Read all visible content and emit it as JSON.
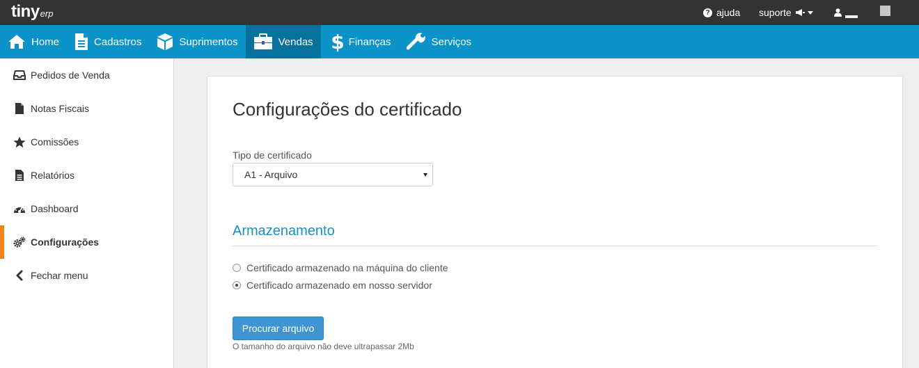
{
  "brand": {
    "name": "tiny",
    "suffix": "erp"
  },
  "topbar": {
    "help_label": "ajuda",
    "help_glyph": "?",
    "support_label": "suporte",
    "icons": [
      "help-circle-icon",
      "megaphone-icon",
      "caret-down-icon",
      "user-icon"
    ]
  },
  "mainnav": {
    "items": [
      {
        "label": "Home",
        "icon": "home-icon"
      },
      {
        "label": "Cadastros",
        "icon": "document-icon"
      },
      {
        "label": "Suprimentos",
        "icon": "box-icon"
      },
      {
        "label": "Vendas",
        "icon": "briefcase-icon",
        "active": true
      },
      {
        "label": "Finanças",
        "icon": "dollar-icon"
      },
      {
        "label": "Serviços",
        "icon": "wrench-icon"
      }
    ]
  },
  "sidebar": {
    "items": [
      {
        "label": "Pedidos de Venda",
        "icon": "inbox-icon"
      },
      {
        "label": "Notas Fiscais",
        "icon": "file-icon"
      },
      {
        "label": "Comissões",
        "icon": "star-icon"
      },
      {
        "label": "Relatórios",
        "icon": "report-icon"
      },
      {
        "label": "Dashboard",
        "icon": "dashboard-icon"
      },
      {
        "label": "Configurações",
        "icon": "cogs-icon",
        "active": true
      },
      {
        "label": "Fechar menu",
        "icon": "chevron-left-icon"
      }
    ]
  },
  "main": {
    "title": "Configurações do certificado",
    "cert_type_label": "Tipo de certificado",
    "cert_type_value": "A1 - Arquivo",
    "storage_title": "Armazenamento",
    "storage_options": [
      {
        "label": "Certificado armazenado na máquina do cliente",
        "checked": false
      },
      {
        "label": "Certificado armazenado em nosso servidor",
        "checked": true
      }
    ],
    "browse_button": "Procurar arquivo",
    "file_hint": "O tamanho do arquivo não deve ultrapassar 2Mb"
  },
  "colors": {
    "topbar": "#333333",
    "nav": "#0b93c9",
    "nav_active": "#07719d",
    "accent_orange": "#f0831e",
    "section_blue": "#1a8fc2",
    "button_blue": "#3f95d2"
  }
}
